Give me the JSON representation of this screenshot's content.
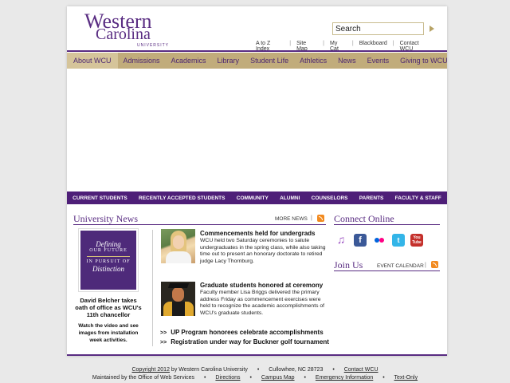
{
  "header": {
    "logo_western": "Western",
    "logo_carolina": "Carolina",
    "logo_university": "UNIVERSITY",
    "search_value": "Search",
    "util_links": [
      "A to Z Index",
      "Site Map",
      "My Cat",
      "Blackboard",
      "Contact WCU"
    ]
  },
  "main_nav": [
    "About WCU",
    "Admissions",
    "Academics",
    "Library",
    "Student Life",
    "Athletics",
    "News",
    "Events",
    "Giving to WCU"
  ],
  "audience_nav": [
    "CURRENT STUDENTS",
    "RECENTLY ACCEPTED STUDENTS",
    "COMMUNITY",
    "ALUMNI",
    "COUNSELORS",
    "PARENTS",
    "FACULTY & STAFF"
  ],
  "news": {
    "title": "University News",
    "more_news": "MORE NEWS",
    "separator": "|",
    "feature": {
      "image_line1": "Defining",
      "image_line2": "OUR FUTURE",
      "image_line3": "IN PURSUIT OF",
      "image_line4": "Distinction",
      "headline": "David Belcher takes oath of office as WCU's 11th chancellor",
      "text": "Watch the video and see images from installation week activities."
    },
    "stories": [
      {
        "title": "Commencements held for undergrads",
        "body": "WCU held two Saturday ceremonies to salute undergraduates in the spring class, while also taking time out to present an honorary doctorate to retired judge Lacy Thornburg."
      },
      {
        "title": "Graduate students honored at ceremony",
        "body": "Faculty member Lisa Briggs delivered the primary address Friday as commencement exercises were held to recognize the academic accomplishments of WCU's graduate students."
      }
    ],
    "more_links": [
      "UP Program honorees celebrate accomplishments",
      "Registration under way for Buckner golf tournament"
    ]
  },
  "connect": {
    "title": "Connect Online",
    "icons": [
      "itunes-icon",
      "facebook-icon",
      "flickr-icon",
      "twitter-icon",
      "youtube-icon"
    ]
  },
  "join": {
    "title": "Join Us",
    "event_calendar": "EVENT CALENDAR",
    "separator": "|"
  },
  "footer": {
    "copyright_link": "Copyright 2012",
    "copyright_rest": "by Western Carolina University",
    "address": "Cullowhee, NC 28723",
    "contact": "Contact WCU",
    "maintained": "Maintained by the Office of Web Services",
    "links": [
      "Directions",
      "Campus Map",
      "Emergency Information",
      "Text-Only"
    ]
  },
  "colors": {
    "purple": "#592c82",
    "gold": "#c1ac7b",
    "audience_bar": "#4e1f78"
  }
}
